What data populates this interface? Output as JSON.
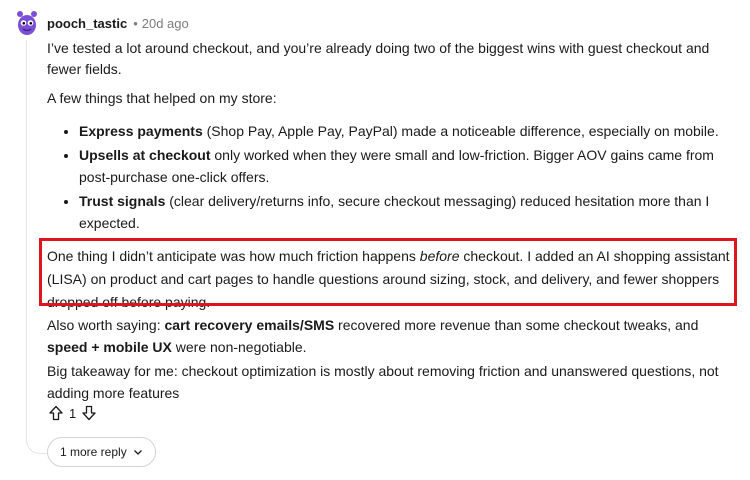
{
  "comment": {
    "username": "pooch_tastic",
    "dot": "•",
    "time_ago": "20d ago",
    "p1": "I’ve tested a lot around checkout, and you’re already doing two of the biggest wins with guest checkout and fewer fields.",
    "p2": "A few things that helped on my store:",
    "bullets": [
      {
        "bold": "Express payments",
        "text": " (Shop Pay, Apple Pay, PayPal) made a noticeable difference, especially on mobile."
      },
      {
        "bold": "Upsells at checkout",
        "text": " only worked when they were small and low-friction. Bigger AOV gains came from post-purchase one-click offers."
      },
      {
        "bold": "Trust signals",
        "text": " (clear delivery/returns info, secure checkout messaging) reduced hesitation more than I expected."
      }
    ],
    "p3_a": "One thing I didn’t anticipate was how much friction happens ",
    "p3_em": "before",
    "p3_b": " checkout. I added an AI shopping assistant (LISA) on product and cart pages to handle questions around sizing, stock, and delivery, and fewer shoppers dropped off before paying.",
    "p4_a": "Also worth saying: ",
    "p4_bold1": "cart recovery emails/SMS",
    "p4_b": " recovered more revenue than some checkout tweaks, and ",
    "p4_bold2": "speed + mobile UX",
    "p4_c": " were non-negotiable.",
    "p5": "Big takeaway for me: checkout optimization is mostly about removing friction and unanswered questions, not adding more features",
    "vote_count": "1"
  },
  "reply_button": {
    "label": "1 more reply"
  },
  "colors": {
    "highlight_border": "#e0141e",
    "avatar": "#7a4fd6",
    "thread_line": "#e2e4e6"
  }
}
